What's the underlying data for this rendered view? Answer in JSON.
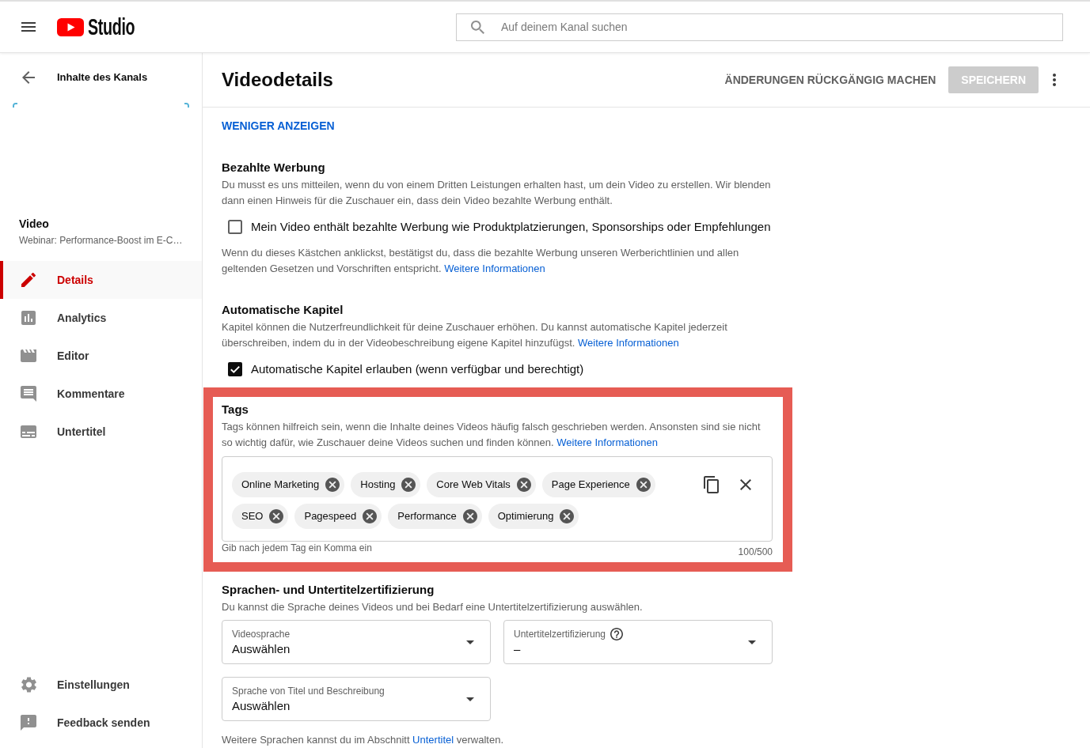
{
  "header": {
    "logo_text": "Studio",
    "search": {
      "placeholder": "Auf deinem Kanal suchen"
    }
  },
  "sidebar": {
    "back_label": "Inhalte des Kanals",
    "video": {
      "heading": "Video",
      "title": "Webinar: Performance-Boost im E-C…"
    },
    "items": [
      {
        "label": "Details",
        "selected": true
      },
      {
        "label": "Analytics",
        "selected": false
      },
      {
        "label": "Editor",
        "selected": false
      },
      {
        "label": "Kommentare",
        "selected": false
      },
      {
        "label": "Untertitel",
        "selected": false
      }
    ],
    "footer_items": [
      {
        "label": "Einstellungen"
      },
      {
        "label": "Feedback senden"
      }
    ]
  },
  "toolbar": {
    "title": "Videodetails",
    "actions": [
      {
        "label": "ÄNDERUNGEN RÜCKGÄNGIG MACHEN",
        "kind": "text",
        "disabled": false
      },
      {
        "label": "SPEICHERN",
        "kind": "filled",
        "disabled": true
      }
    ]
  },
  "show_less_link": "WENIGER ANZEIGEN",
  "paid_promotion": {
    "title": "Bezahlte Werbung",
    "description": "Du musst es uns mitteilen, wenn du von einem Dritten Leistungen erhalten hast, um dein Video zu erstellen. Wir blenden dann einen Hinweis für die Zuschauer ein, dass dein Video bezahlte Werbung enthält.",
    "checkbox": {
      "label": "Mein Video enthält bezahlte Werbung wie Produktplatzierungen, Sponsorships oder Empfehlungen",
      "checked": false
    },
    "note": "Wenn du dieses Kästchen anklickst, bestätigst du, dass die bezahlte Werbung unseren Werberichtlinien und allen geltenden Gesetzen und Vorschriften entspricht. ",
    "link": "Weitere Informationen"
  },
  "auto_chapters": {
    "title": "Automatische Kapitel",
    "description": "Kapitel können die Nutzerfreundlichkeit für deine Zuschauer erhöhen. Du kannst automatische Kapitel jederzeit überschreiben, indem du in der Videobeschreibung eigene Kapitel hinzufügst. ",
    "link": "Weitere Informationen",
    "checkbox": {
      "label": "Automatische Kapitel erlauben (wenn verfügbar und berechtigt)",
      "checked": true
    }
  },
  "tags": {
    "highlighted": true,
    "title": "Tags",
    "description": "Tags können hilfreich sein, wenn die Inhalte deines Videos häufig falsch geschrieben werden. Ansonsten sind sie nicht so wichtig dafür, wie Zuschauer deine Videos suchen und finden können. ",
    "link": "Weitere Informationen",
    "items": [
      {
        "label": "Online Marketing"
      },
      {
        "label": "Hosting"
      },
      {
        "label": "Core Web Vitals"
      },
      {
        "label": "Page Experience"
      },
      {
        "label": "SEO"
      },
      {
        "label": "Pagespeed"
      },
      {
        "label": "Performance"
      },
      {
        "label": "Optimierung"
      }
    ],
    "hint": "Gib nach jedem Tag ein Komma ein",
    "counter": "100/500"
  },
  "languages": {
    "title": "Sprachen- und Untertitelzertifizierung",
    "description": "Du kannst die Sprache deines Videos und bei Bedarf eine Untertitelzertifizierung auswählen.",
    "dropdowns": [
      {
        "label": "Videosprache",
        "value": "Auswählen",
        "help": false
      },
      {
        "label": "Untertitelzertifizierung",
        "value": "–",
        "help": true
      },
      {
        "label": "Sprache von Titel und Beschreibung",
        "value": "Auswählen",
        "help": false
      }
    ],
    "footer": {
      "text_before": "Weitere Sprachen kannst du im Abschnitt ",
      "link": "Untertitel",
      "text_after": " verwalten."
    }
  }
}
